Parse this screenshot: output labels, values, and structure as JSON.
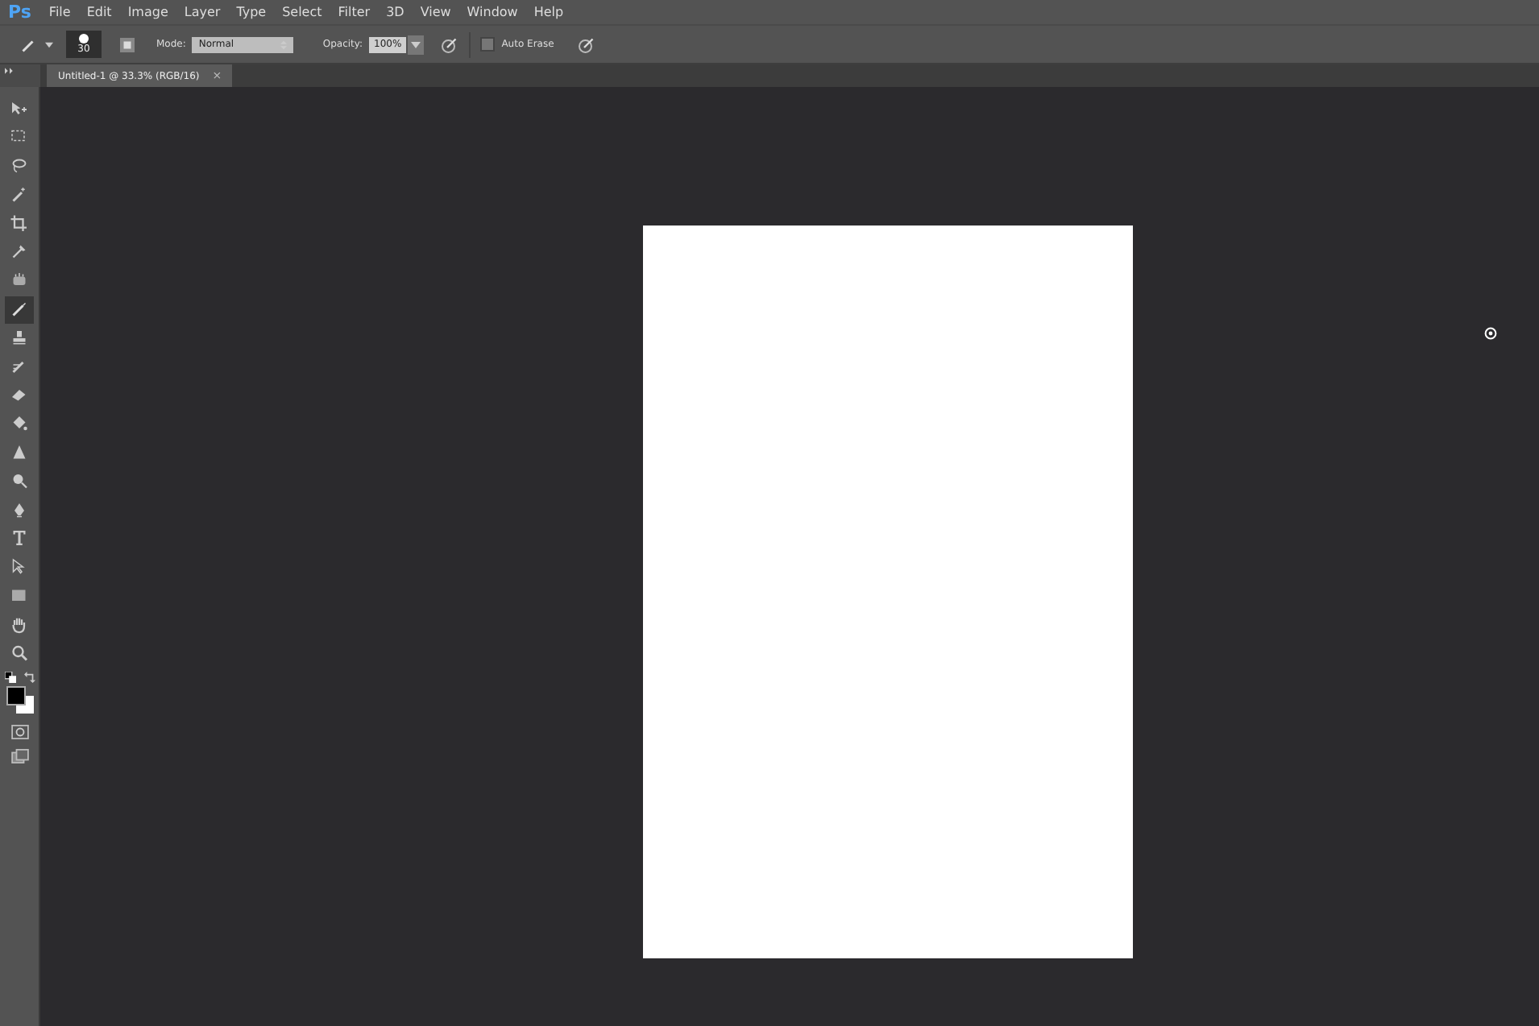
{
  "app_logo": "Ps",
  "menu": [
    {
      "label": "File"
    },
    {
      "label": "Edit"
    },
    {
      "label": "Image"
    },
    {
      "label": "Layer"
    },
    {
      "label": "Type"
    },
    {
      "label": "Select"
    },
    {
      "label": "Filter"
    },
    {
      "label": "3D"
    },
    {
      "label": "View"
    },
    {
      "label": "Window"
    },
    {
      "label": "Help"
    }
  ],
  "options_bar": {
    "brush_size": "30",
    "mode_label": "Mode:",
    "mode_value": "Normal",
    "opacity_label": "Opacity:",
    "opacity_value": "100%",
    "auto_erase": {
      "label": "Auto Erase",
      "checked": false
    }
  },
  "document_tab": {
    "title": "Untitled-1 @ 33.3% (RGB/16)",
    "close": "×",
    "selected": true
  },
  "tools": [
    {
      "selected": false
    },
    {
      "selected": false
    },
    {
      "selected": false
    },
    {
      "selected": false
    },
    {
      "selected": false
    },
    {
      "selected": false
    },
    {
      "selected": false
    },
    {
      "selected": true
    },
    {
      "selected": false
    },
    {
      "selected": false
    },
    {
      "selected": false
    },
    {
      "selected": false
    },
    {
      "selected": false
    },
    {
      "selected": false
    },
    {
      "selected": false
    },
    {
      "selected": false
    },
    {
      "selected": false
    },
    {
      "selected": false
    },
    {
      "selected": false
    },
    {
      "selected": false
    }
  ]
}
